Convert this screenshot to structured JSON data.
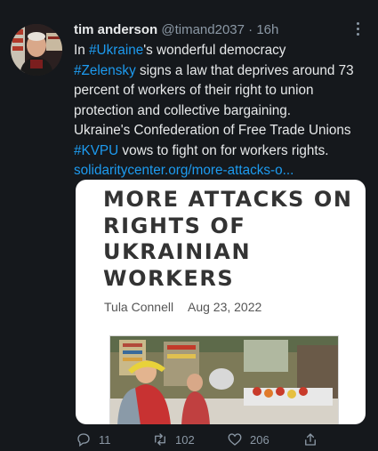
{
  "author": {
    "name": "tim anderson",
    "handle": "@timand2037",
    "separator": "·",
    "time": "16h"
  },
  "tweet": {
    "lines": [
      [
        {
          "t": "In "
        },
        {
          "t": "#Ukraine",
          "link": true
        },
        {
          "t": "'s wonderful democracy"
        }
      ],
      [
        {
          "t": "#Zelensky",
          "link": true
        },
        {
          "t": " signs a law that deprives around 73"
        }
      ],
      [
        {
          "t": "percent of workers of their right to union"
        }
      ],
      [
        {
          "t": "protection and collective bargaining."
        }
      ],
      [
        {
          "t": "Ukraine's Confederation of Free Trade Unions"
        }
      ],
      [
        {
          "t": "#KVPU",
          "link": true
        },
        {
          "t": " vows to fight on for workers rights."
        }
      ],
      [
        {
          "t": "solidaritycenter.org/more-attacks-o...",
          "link": true
        }
      ]
    ]
  },
  "card": {
    "title_lines": [
      "MORE ATTACKS ON",
      "RIGHTS OF",
      "UKRAINIAN",
      "WORKERS"
    ],
    "author": "Tula Connell",
    "date": "Aug 23, 2022"
  },
  "actions": {
    "reply_count": "11",
    "retweet_count": "102",
    "like_count": "206"
  },
  "colors": {
    "background": "#15181c",
    "link": "#1d9bf0",
    "secondary_text": "#8b98a5"
  },
  "icons": [
    "more-icon",
    "reply-icon",
    "retweet-icon",
    "like-icon",
    "share-icon"
  ]
}
